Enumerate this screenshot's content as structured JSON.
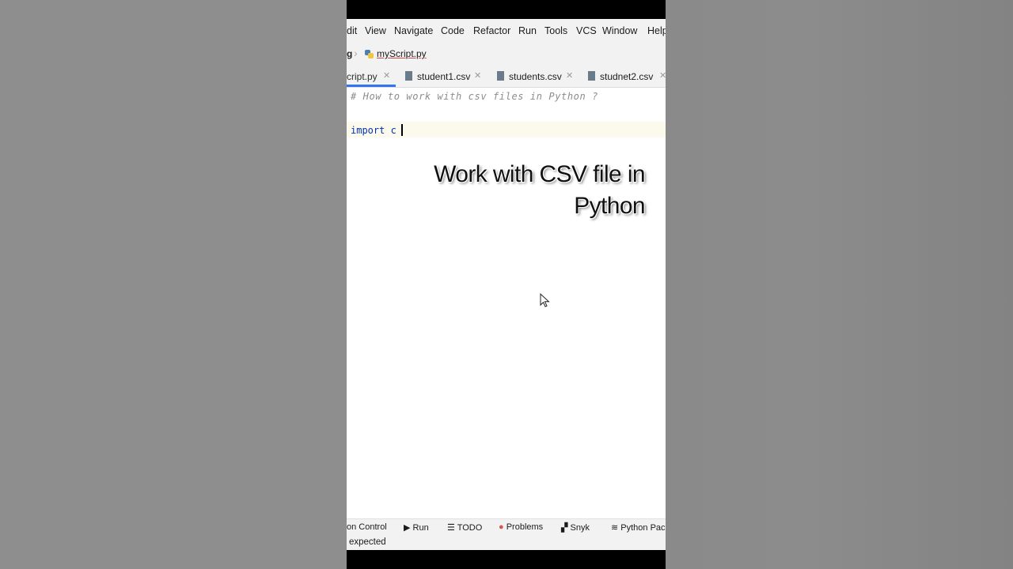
{
  "menu": [
    "dit",
    "View",
    "Navigate",
    "Code",
    "Refactor",
    "Run",
    "Tools",
    "VCS",
    "Window",
    "Help"
  ],
  "breadcrumb": {
    "project": "g",
    "file": "myScript.py"
  },
  "tabs": [
    {
      "label": "cript.py",
      "active": true
    },
    {
      "label": "student1.csv",
      "active": false
    },
    {
      "label": "students.csv",
      "active": false
    },
    {
      "label": "studnet2.csv",
      "active": false
    }
  ],
  "editor": {
    "comment": "# How to work with csv files in Python ?",
    "line": "import c"
  },
  "overlay": {
    "line1": "Work with CSV file in",
    "line2": "Python"
  },
  "tool_windows": [
    "on Control",
    "Run",
    "TODO",
    "Problems",
    "Snyk",
    "Python Pac"
  ],
  "status": {
    "text": "expected"
  },
  "colors": {
    "accent": "#3574f0",
    "keyword": "#0033b3",
    "comment": "#8c8c8c"
  }
}
